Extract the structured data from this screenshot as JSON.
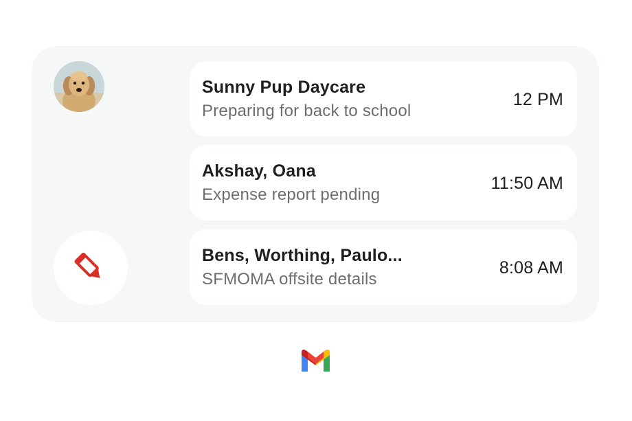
{
  "widget": {
    "avatar_icon": "dog-avatar",
    "compose_icon": "pencil-icon",
    "accent_color": "#d93025",
    "threads": [
      {
        "sender": "Sunny Pup Daycare",
        "snippet": "Preparing for back to school",
        "time": "12 PM"
      },
      {
        "sender": "Akshay, Oana",
        "snippet": "Expense report pending",
        "time": "11:50 AM"
      },
      {
        "sender": "Bens, Worthing, Paulo...",
        "snippet": "SFMOMA offsite details",
        "time": "8:08 AM"
      }
    ]
  },
  "footer": {
    "logo_icon": "gmail-logo-icon"
  }
}
